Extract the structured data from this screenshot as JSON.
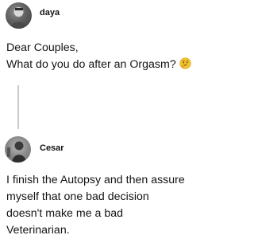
{
  "thread": {
    "first": {
      "username": "daya",
      "avatar_icon": "profile-photo-icon",
      "text_lines": [
        "Dear Couples,",
        "What do you do after an Orgasm?"
      ],
      "emoji_icon": "thinking-face-icon"
    },
    "reply": {
      "username": "Cesar",
      "avatar_icon": "profile-photo-icon",
      "text_lines": [
        "I finish the Autopsy and then assure",
        "myself that one bad decision",
        "doesn't make me a bad",
        "Veterinarian."
      ]
    }
  },
  "colors": {
    "background": "#ffffff",
    "text": "#141414",
    "connector": "#c9c9c9",
    "emoji": "#f4c430"
  }
}
